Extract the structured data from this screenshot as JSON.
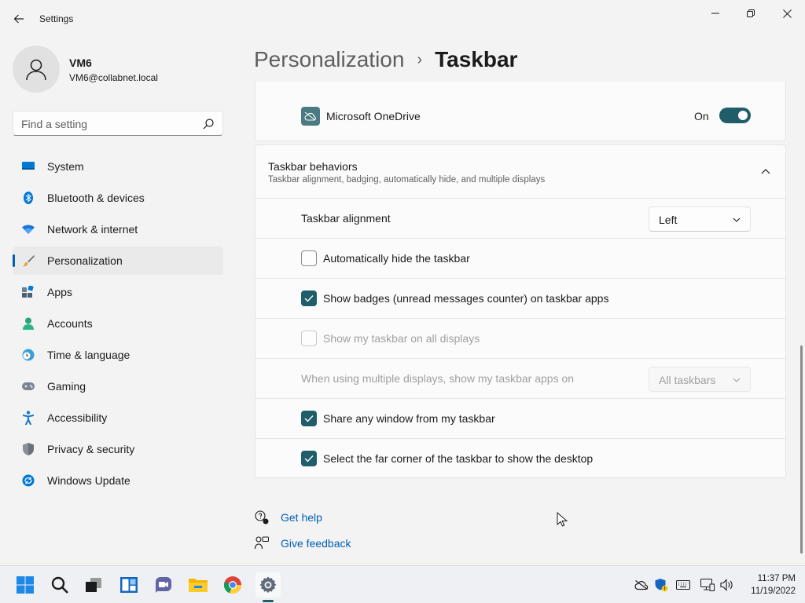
{
  "window": {
    "title": "Settings"
  },
  "profile": {
    "name": "VM6",
    "email": "VM6@collabnet.local"
  },
  "search": {
    "placeholder": "Find a setting"
  },
  "sidebar": {
    "items": [
      {
        "label": "System",
        "icon": "system-icon"
      },
      {
        "label": "Bluetooth & devices",
        "icon": "bluetooth-icon"
      },
      {
        "label": "Network & internet",
        "icon": "wifi-icon"
      },
      {
        "label": "Personalization",
        "icon": "brush-icon",
        "active": true
      },
      {
        "label": "Apps",
        "icon": "apps-icon"
      },
      {
        "label": "Accounts",
        "icon": "person-icon"
      },
      {
        "label": "Time & language",
        "icon": "clock-globe-icon"
      },
      {
        "label": "Gaming",
        "icon": "gamepad-icon"
      },
      {
        "label": "Accessibility",
        "icon": "accessibility-icon"
      },
      {
        "label": "Privacy & security",
        "icon": "shield-icon"
      },
      {
        "label": "Windows Update",
        "icon": "update-icon"
      }
    ]
  },
  "breadcrumb": {
    "parent": "Personalization",
    "separator": "›",
    "current": "Taskbar"
  },
  "onedrive": {
    "label": "Microsoft OneDrive",
    "state": "On",
    "enabled": true
  },
  "behaviors": {
    "title": "Taskbar behaviors",
    "subtitle": "Taskbar alignment, badging, automatically hide, and multiple displays",
    "alignment": {
      "label": "Taskbar alignment",
      "value": "Left"
    },
    "auto_hide": {
      "label": "Automatically hide the taskbar",
      "checked": false
    },
    "badges": {
      "label": "Show badges (unread messages counter) on taskbar apps",
      "checked": true
    },
    "all_displays": {
      "label": "Show my taskbar on all displays",
      "checked": false,
      "disabled": true
    },
    "multi_display": {
      "label": "When using multiple displays, show my taskbar apps on",
      "value": "All taskbars",
      "disabled": true
    },
    "share_window": {
      "label": "Share any window from my taskbar",
      "checked": true
    },
    "far_corner": {
      "label": "Select the far corner of the taskbar to show the desktop",
      "checked": true
    }
  },
  "links": {
    "help": "Get help",
    "feedback": "Give feedback"
  },
  "taskbar": {
    "time": "11:37 PM",
    "date": "11/19/2022",
    "apps": [
      "start-icon",
      "search-icon",
      "task-view-icon",
      "widgets-icon",
      "chat-icon",
      "file-explorer-icon",
      "chrome-icon",
      "settings-icon"
    ]
  },
  "colors": {
    "accent": "#1f5e68",
    "link": "#005fb8",
    "nav_indicator": "#005fb8"
  }
}
